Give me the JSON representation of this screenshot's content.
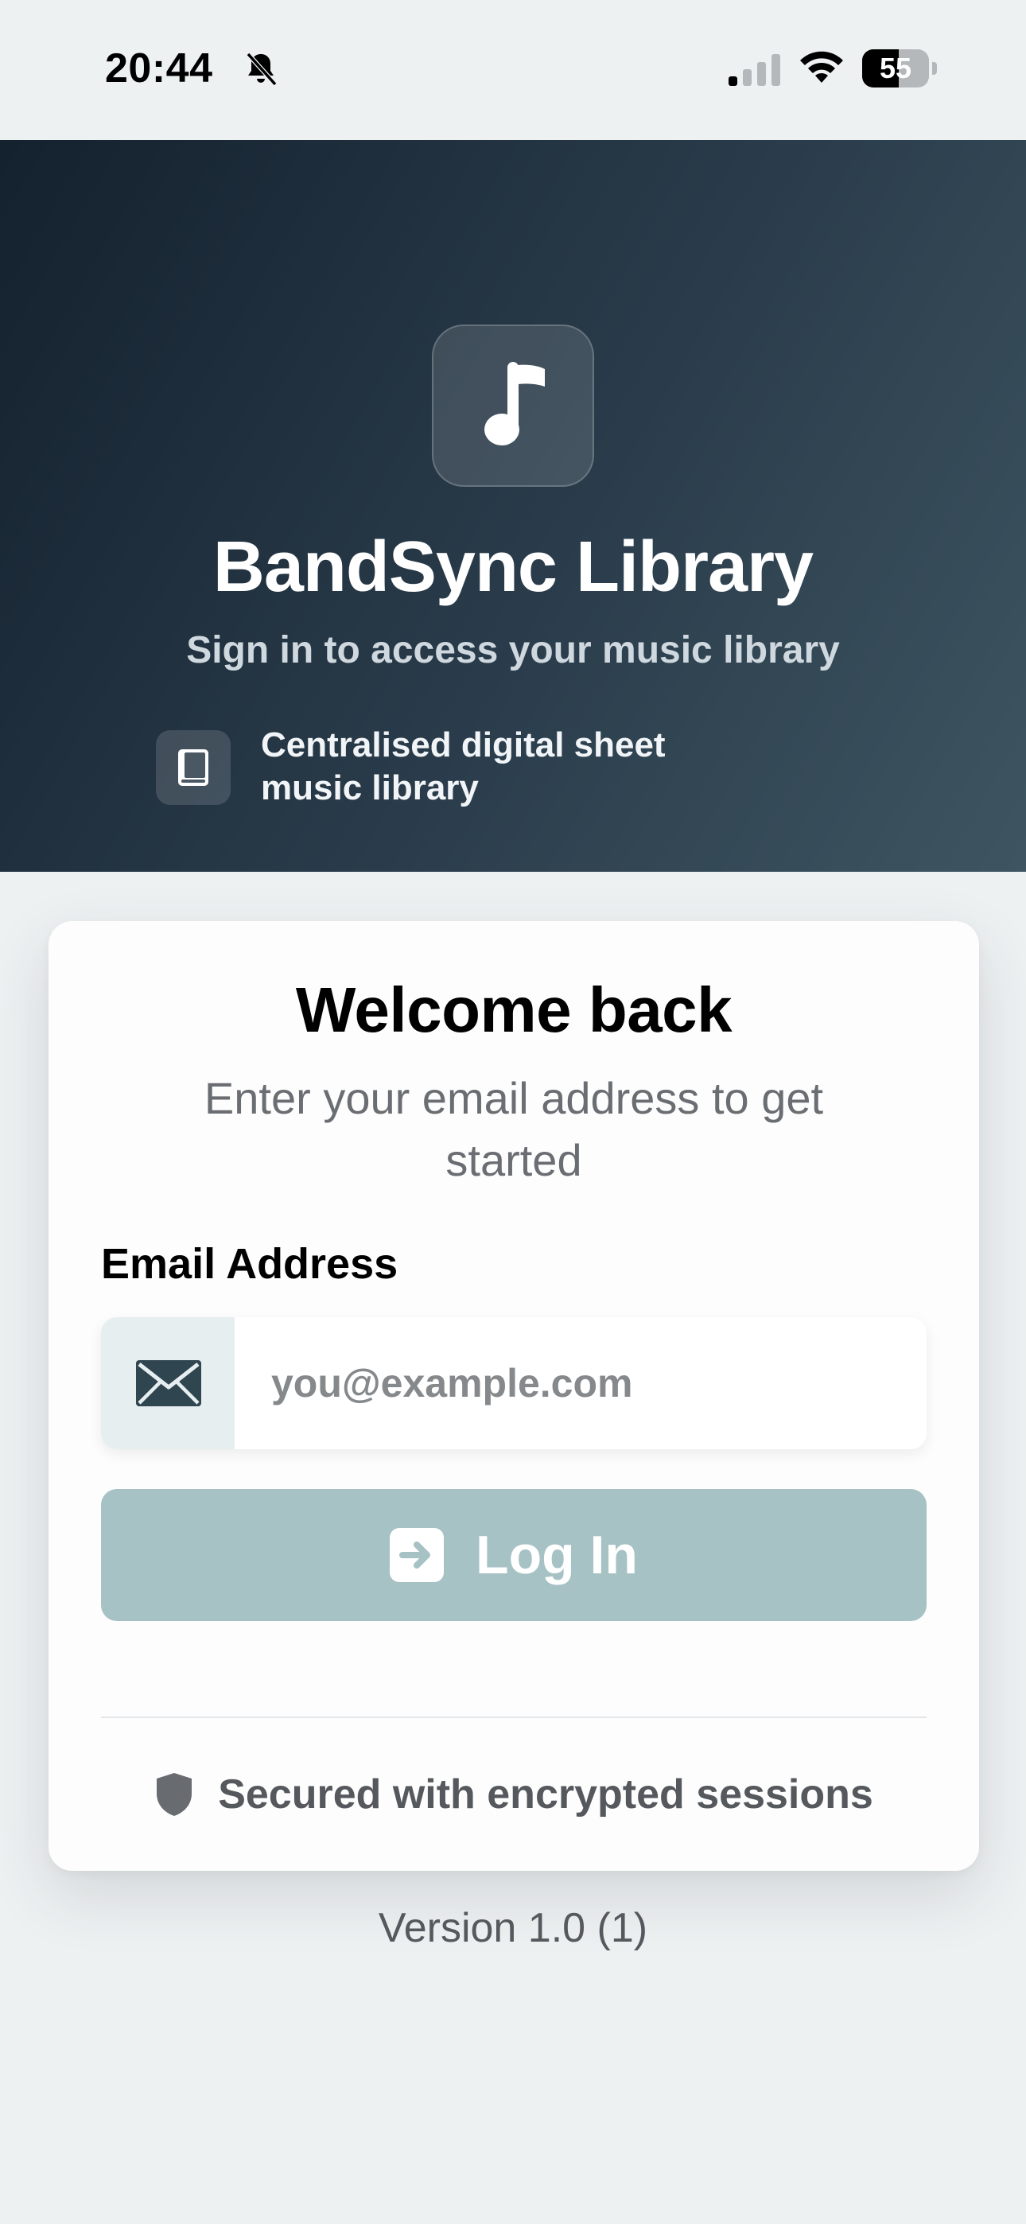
{
  "status_bar": {
    "time": "20:44",
    "battery_level": "55"
  },
  "hero": {
    "title": "BandSync Library",
    "subtitle": "Sign in to access your music library",
    "feature_text": "Centralised digital sheet music library"
  },
  "card": {
    "title": "Welcome back",
    "subtitle": "Enter your email address to get started",
    "email_label": "Email Address",
    "email_placeholder": "you@example.com",
    "email_value": "",
    "login_label": "Log In",
    "secured_text": "Secured with encrypted sessions"
  },
  "footer": {
    "version": "Version 1.0 (1)"
  },
  "colors": {
    "hero_gradient_start": "#14212e",
    "hero_gradient_end": "#3e5561",
    "login_button": "#a7c2c4",
    "background": "#eef1f2"
  },
  "icons": {
    "hero": "music-note-icon",
    "feature": "book-icon",
    "email": "envelope-icon",
    "login": "arrow-right-square-icon",
    "security": "shield-icon"
  }
}
